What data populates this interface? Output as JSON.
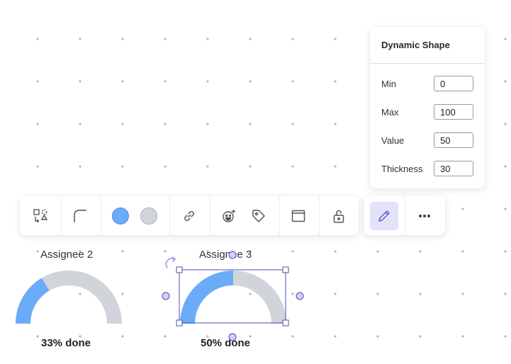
{
  "panel": {
    "title": "Dynamic Shape",
    "fields": [
      {
        "label": "Min",
        "value": "0"
      },
      {
        "label": "Max",
        "value": "100"
      },
      {
        "label": "Value",
        "value": "50"
      },
      {
        "label": "Thickness",
        "value": "30"
      }
    ]
  },
  "toolbar": {
    "fill_color": "#6aacf8",
    "border_color": "#d1d5db",
    "active_tool": "edit"
  },
  "gauges": [
    {
      "title": "Assignee 2",
      "caption": "33% done",
      "value": 33,
      "min": 0,
      "max": 100,
      "selected": false
    },
    {
      "title": "Assignee 3",
      "caption": "50% done",
      "value": 50,
      "min": 0,
      "max": 100,
      "selected": true
    }
  ],
  "colors": {
    "gauge_fill": "#6aacf8",
    "gauge_track": "#d1d5db",
    "selection": "#4a4fb5",
    "handle_fill": "#cfd0fb"
  }
}
